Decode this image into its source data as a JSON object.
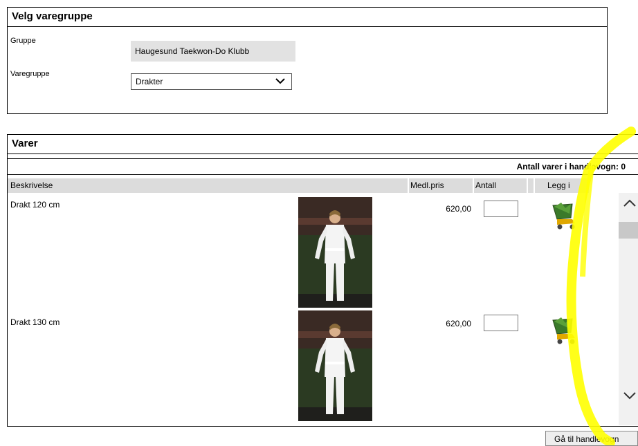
{
  "group_panel": {
    "title": "Velg varegruppe",
    "gruppe_label": "Gruppe",
    "gruppe_value": "Haugesund Taekwon-Do Klubb",
    "varegruppe_label": "Varegruppe",
    "varegruppe_selected": "Drakter"
  },
  "items_panel": {
    "title": "Varer",
    "cart_count": "Antall varer i handlevogn: 0",
    "columns": {
      "description": "Beskrivelse",
      "price": "Medl.pris",
      "quantity": "Antall",
      "add": "Legg i"
    },
    "items": [
      {
        "description": "Drakt 120 cm",
        "price": "620,00",
        "quantity": ""
      },
      {
        "description": "Drakt 130 cm",
        "price": "620,00",
        "quantity": ""
      }
    ]
  },
  "footer": {
    "goto_cart": "Gå til handlevogn"
  },
  "icons": {
    "add_to_cart": "shopping-cart-icon",
    "scroll_up": "chevron-up-icon",
    "scroll_down": "chevron-down-icon"
  },
  "colors": {
    "highlight": "#ffff00",
    "header_bg": "#dcdcdc",
    "readonly_bg": "#e2e2e2"
  }
}
